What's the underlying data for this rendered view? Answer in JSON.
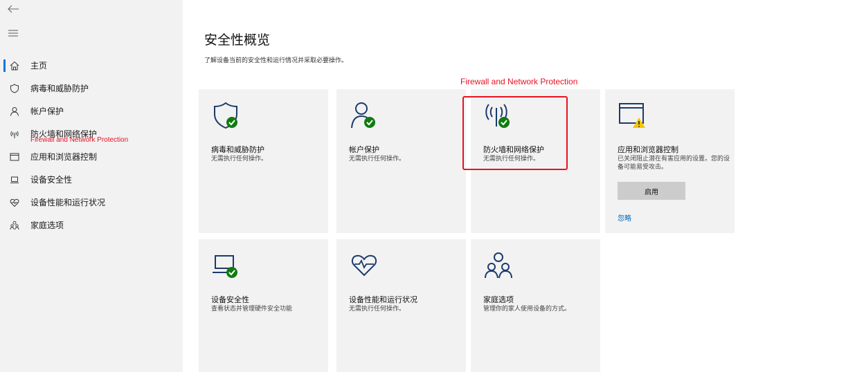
{
  "sidebar": {
    "items": [
      {
        "label": "主页",
        "icon": "home-icon"
      },
      {
        "label": "病毒和威胁防护",
        "icon": "shield-icon"
      },
      {
        "label": "帐户保护",
        "icon": "person-icon"
      },
      {
        "label": "防火墙和网络保护",
        "icon": "wifi-icon"
      },
      {
        "label": "应用和浏览器控制",
        "icon": "app-window-icon"
      },
      {
        "label": "设备安全性",
        "icon": "laptop-icon"
      },
      {
        "label": "设备性能和运行状况",
        "icon": "heart-icon"
      },
      {
        "label": "家庭选项",
        "icon": "family-icon"
      }
    ],
    "annotation": "Firewall and Network Protection"
  },
  "main": {
    "title": "安全性概览",
    "subtitle": "了解设备当前的安全性和运行情况并采取必要操作。",
    "annotation": "Firewall and Network Protection",
    "cards": [
      {
        "title": "病毒和威胁防护",
        "desc": "无需执行任何操作。",
        "icon": "shield-check-icon"
      },
      {
        "title": "帐户保护",
        "desc": "无需执行任何操作。",
        "icon": "person-check-icon"
      },
      {
        "title": "防火墙和网络保护",
        "desc": "无需执行任何操作。",
        "icon": "wifi-check-icon"
      },
      {
        "title": "应用和浏览器控制",
        "desc": "已关闭阻止潜在有害应用的设置。您的设备可能易受攻击。",
        "icon": "app-window-warning-icon",
        "button": "启用",
        "link": "忽略"
      },
      {
        "title": "设备安全性",
        "desc": "查看状态并管理硬件安全功能",
        "icon": "laptop-check-icon"
      },
      {
        "title": "设备性能和运行状况",
        "desc": "无需执行任何操作。",
        "icon": "heart-pulse-icon"
      },
      {
        "title": "家庭选项",
        "desc": "管理你的家人使用设备的方式。",
        "icon": "family-icon"
      }
    ]
  },
  "colors": {
    "accent": "#0078d4",
    "ok": "#107c10",
    "warn": "#f7c600",
    "annotation": "#e81123",
    "link": "#0067b8"
  }
}
